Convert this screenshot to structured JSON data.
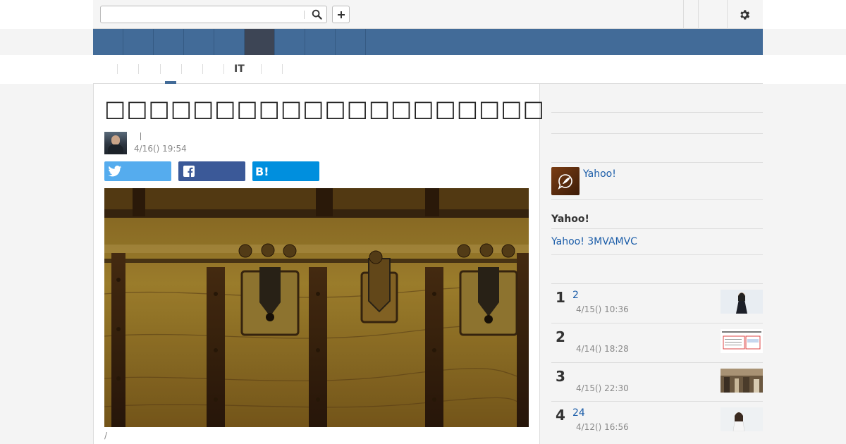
{
  "search": {
    "value": "",
    "placeholder": ""
  },
  "icons": {
    "search": "search-icon",
    "plus": "plus-icon",
    "settings": "gear-icon",
    "twitter": "twitter-icon",
    "facebook": "facebook-icon",
    "hatena": "hatena-bookmark-icon"
  },
  "colors": {
    "nav_bg": "#426b98",
    "nav_active": "#3d4555",
    "link": "#1a5ca8",
    "twitter": "#55acee",
    "facebook": "#3b5998",
    "hatena": "#008fde"
  },
  "nav": {
    "items": [
      "",
      "",
      "",
      "",
      "",
      "",
      "",
      "",
      ""
    ],
    "active_index": 5
  },
  "subnav": {
    "label": "IT"
  },
  "article": {
    "title": "□□□□□□□□□□□□□□□□□□□□",
    "author_separator": "|",
    "date": "4/16() 19:54",
    "hatena_label": "B!",
    "caption": "/"
  },
  "sidebar": {
    "promo_link": "Yahoo!",
    "heading": "Yahoo!",
    "link": "Yahoo! 3MVAMVC",
    "ranking": [
      {
        "rank": "1",
        "title": "2",
        "date": "4/15() 10:36"
      },
      {
        "rank": "2",
        "title": "",
        "date": "4/14() 18:28"
      },
      {
        "rank": "3",
        "title": "",
        "date": "4/15() 22:30"
      },
      {
        "rank": "4",
        "title": "24",
        "date": "4/12() 16:56"
      }
    ]
  }
}
